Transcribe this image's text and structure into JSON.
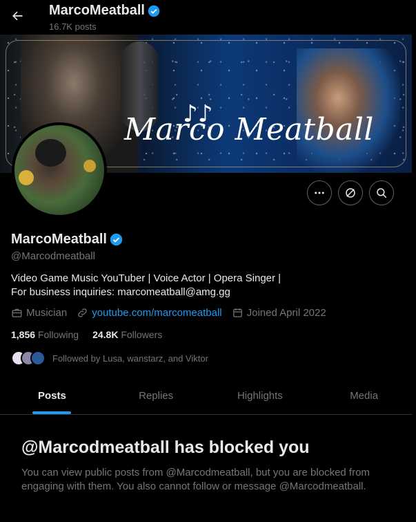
{
  "header": {
    "name": "MarcoMeatball",
    "post_count": "16.7K posts"
  },
  "banner": {
    "logo_mark": "♪♪",
    "title": "Marco Meatball"
  },
  "profile": {
    "display_name": "MarcoMeatball",
    "handle": "@Marcodmeatball",
    "bio_line1": "Video Game Music YouTuber | Voice Actor | Opera Singer |",
    "bio_line2": "For business inquiries: marcomeatball@amg.gg",
    "category": "Musician",
    "link": "youtube.com/marcomeatball",
    "joined": "Joined April 2022",
    "following_count": "1,856",
    "following_label": "Following",
    "followers_count": "24.8K",
    "followers_label": "Followers",
    "followed_by": "Followed by Lusa, wanstarz, and Viktor"
  },
  "actions": {
    "more_icon": "more-icon",
    "grok_icon": "grok-icon",
    "search_icon": "search-icon"
  },
  "tabs": [
    {
      "label": "Posts",
      "active": true
    },
    {
      "label": "Replies",
      "active": false
    },
    {
      "label": "Highlights",
      "active": false
    },
    {
      "label": "Media",
      "active": false
    }
  ],
  "blocked": {
    "title": "@Marcodmeatball has blocked you",
    "body": "You can view public posts from @Marcodmeatball, but you are blocked from engaging with them. You also cannot follow or message @Marcodmeatball."
  },
  "colors": {
    "accent": "#1d9bf0",
    "verified": "#1d9bf0",
    "muted": "#71767b",
    "text": "#e7e9ea",
    "background": "#000000"
  }
}
